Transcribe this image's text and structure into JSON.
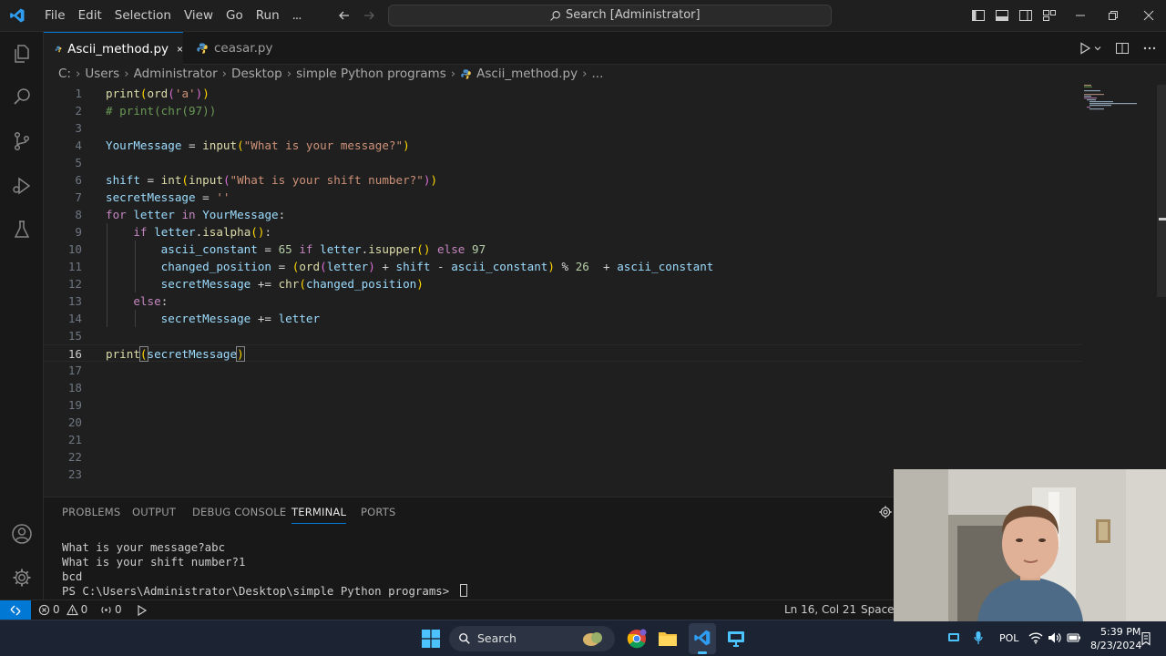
{
  "titlebar": {
    "menu": [
      "File",
      "Edit",
      "Selection",
      "View",
      "Go",
      "Run",
      "..."
    ],
    "search": "Search [Administrator]"
  },
  "tabs": [
    {
      "label": "Ascii_method.py",
      "active": true
    },
    {
      "label": "ceasar.py",
      "active": false
    }
  ],
  "breadcrumb": [
    "C:",
    "Users",
    "Administrator",
    "Desktop",
    "simple Python programs",
    "Ascii_method.py",
    "..."
  ],
  "editor": {
    "line_numbers": [
      "1",
      "2",
      "3",
      "4",
      "5",
      "6",
      "7",
      "8",
      "9",
      "10",
      "11",
      "12",
      "13",
      "14",
      "15",
      "16",
      "17",
      "18",
      "19",
      "20",
      "21",
      "22",
      "23"
    ],
    "current_line": 16
  },
  "panel": {
    "tabs": [
      "PROBLEMS",
      "OUTPUT",
      "DEBUG CONSOLE",
      "TERMINAL",
      "PORTS"
    ],
    "active_tab": "TERMINAL",
    "terminal_lines": [
      "What is your message?abc",
      "What is your shift number?1",
      "bcd",
      "PS C:\\Users\\Administrator\\Desktop\\simple Python programs> "
    ]
  },
  "statusbar": {
    "errors": "0",
    "warnings": "0",
    "ports": "0",
    "position": "Ln 16, Col 21",
    "indent": "Spaces"
  },
  "taskbar": {
    "search": "Search",
    "lang": "POL",
    "time": "5:39 PM",
    "date": "8/23/2024"
  },
  "colors": {
    "accent": "#0078d4",
    "background": "#1f1f1f",
    "keyword": "#c586c0",
    "function": "#dcdcaa",
    "variable": "#9cdcfe",
    "string": "#ce9178",
    "number": "#b5cea8",
    "comment": "#6a9955"
  }
}
